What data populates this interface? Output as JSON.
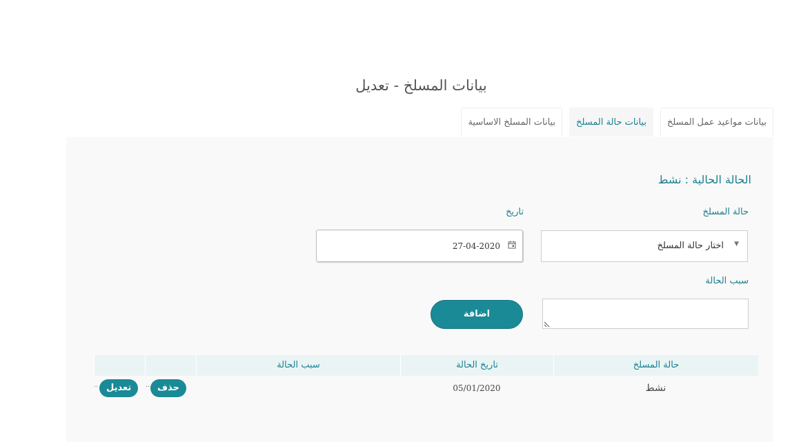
{
  "page": {
    "title": "بيانات المسلخ - تعديل"
  },
  "tabs": [
    {
      "label": "بيانات المسلخ الاساسية",
      "active": false
    },
    {
      "label": "بيانات حالة المسلخ",
      "active": true
    },
    {
      "label": "بيانات مواعيد عمل المسلخ",
      "active": false
    }
  ],
  "form": {
    "current_status": "الحالة الحالية : نشط",
    "status_label": "حالة المسلخ",
    "status_select_value": "اختار حالة المسلخ",
    "date_label": "تاريخ",
    "date_value": "27-04-2020",
    "reason_label": "سبب الحالة",
    "reason_value": "",
    "add_button": "اضافة"
  },
  "table": {
    "headers": [
      "حالة المسلخ",
      "تاريخ الحالة",
      "سبب الحالة",
      "",
      ""
    ],
    "rows": [
      {
        "status": "نشط",
        "date": "05/01/2020",
        "reason": "",
        "delete_label": "حذف",
        "edit_label": "تعديل"
      }
    ]
  },
  "colors": {
    "accent": "#1a8a96",
    "accent_text": "#1a7f8e",
    "panel_bg": "#f9f9f9",
    "table_header_bg": "#eaf4f5"
  }
}
